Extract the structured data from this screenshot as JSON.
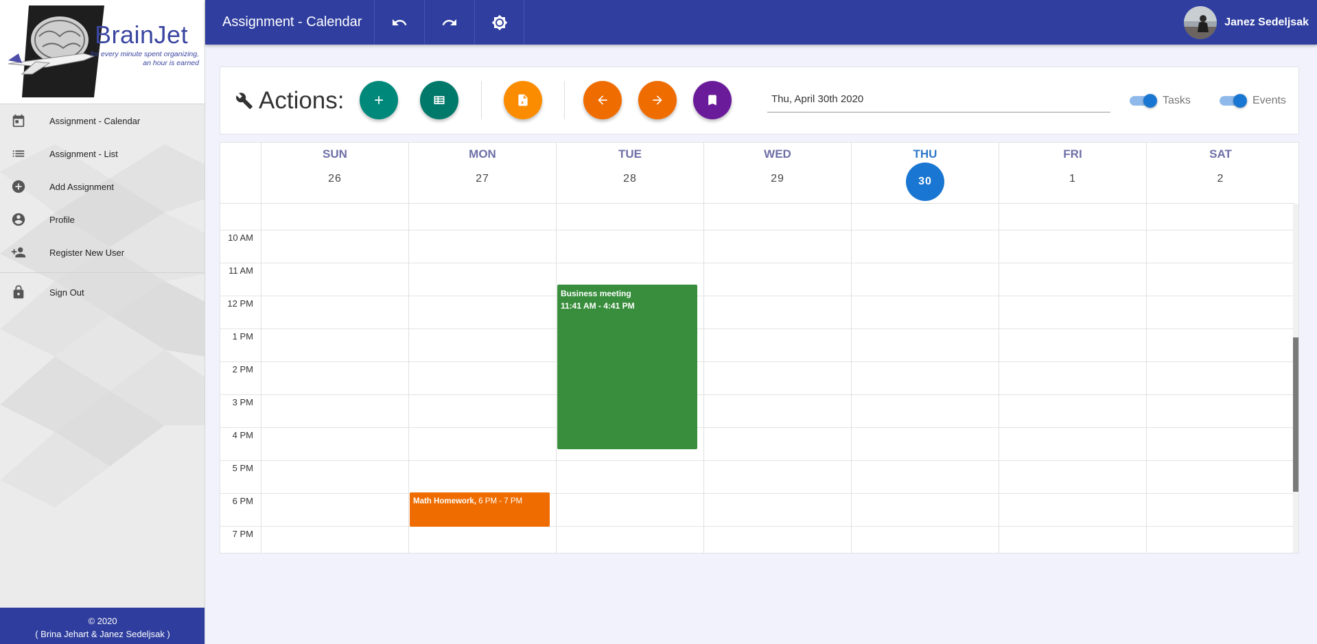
{
  "sidebar": {
    "logo": {
      "title": "BrainJet",
      "tagline": "for every minute spent organizing, an hour is earned"
    },
    "items": [
      {
        "label": "Assignment - Calendar",
        "icon": "calendar-icon"
      },
      {
        "label": "Assignment - List",
        "icon": "list-icon"
      },
      {
        "label": "Add Assignment",
        "icon": "add-circle-icon"
      },
      {
        "label": "Profile",
        "icon": "account-circle-icon"
      },
      {
        "label": "Register New User",
        "icon": "person-add-icon"
      }
    ],
    "signout": {
      "label": "Sign Out",
      "icon": "lock-icon"
    },
    "footer": {
      "line1": "© 2020",
      "line2": "( Brina Jehart & Janez Sedeljsak )"
    }
  },
  "header": {
    "title": "Assignment - Calendar",
    "buttons": [
      "undo-icon",
      "redo-icon",
      "brightness-icon"
    ],
    "user": {
      "name": "Janez Sedeljsak"
    },
    "color": "#303f9f"
  },
  "actions": {
    "label": "Actions:",
    "buttons": [
      {
        "icon": "plus-icon",
        "color": "#00897b"
      },
      {
        "icon": "table-icon",
        "color": "#00796b"
      },
      {
        "icon": "pdf-icon",
        "color": "#fb8c00"
      },
      {
        "icon": "arrow-left-icon",
        "color": "#ef6c00"
      },
      {
        "icon": "arrow-right-icon",
        "color": "#ef6c00"
      },
      {
        "icon": "bookmark-icon",
        "color": "#6a1b9a"
      }
    ],
    "date": "Thu, April 30th 2020",
    "toggles": [
      {
        "label": "Tasks",
        "on": true
      },
      {
        "label": "Events",
        "on": true
      }
    ]
  },
  "calendar": {
    "days": [
      {
        "name": "SUN",
        "date": "26"
      },
      {
        "name": "MON",
        "date": "27"
      },
      {
        "name": "TUE",
        "date": "28"
      },
      {
        "name": "WED",
        "date": "29"
      },
      {
        "name": "THU",
        "date": "30",
        "today": true
      },
      {
        "name": "FRI",
        "date": "1"
      },
      {
        "name": "SAT",
        "date": "2"
      }
    ],
    "times": [
      "10 AM",
      "11 AM",
      "12 PM",
      "1 PM",
      "2 PM",
      "3 PM",
      "4 PM",
      "5 PM",
      "6 PM",
      "7 PM"
    ],
    "events": [
      {
        "title": "Business meeting",
        "time": "11:41 AM - 4:41 PM",
        "day": "TUE",
        "color": "#388e3c"
      },
      {
        "title": "Math Homework,",
        "time": "6 PM - 7 PM",
        "day": "MON",
        "color": "#ef6c00"
      }
    ],
    "today_color": "#1976d2"
  }
}
